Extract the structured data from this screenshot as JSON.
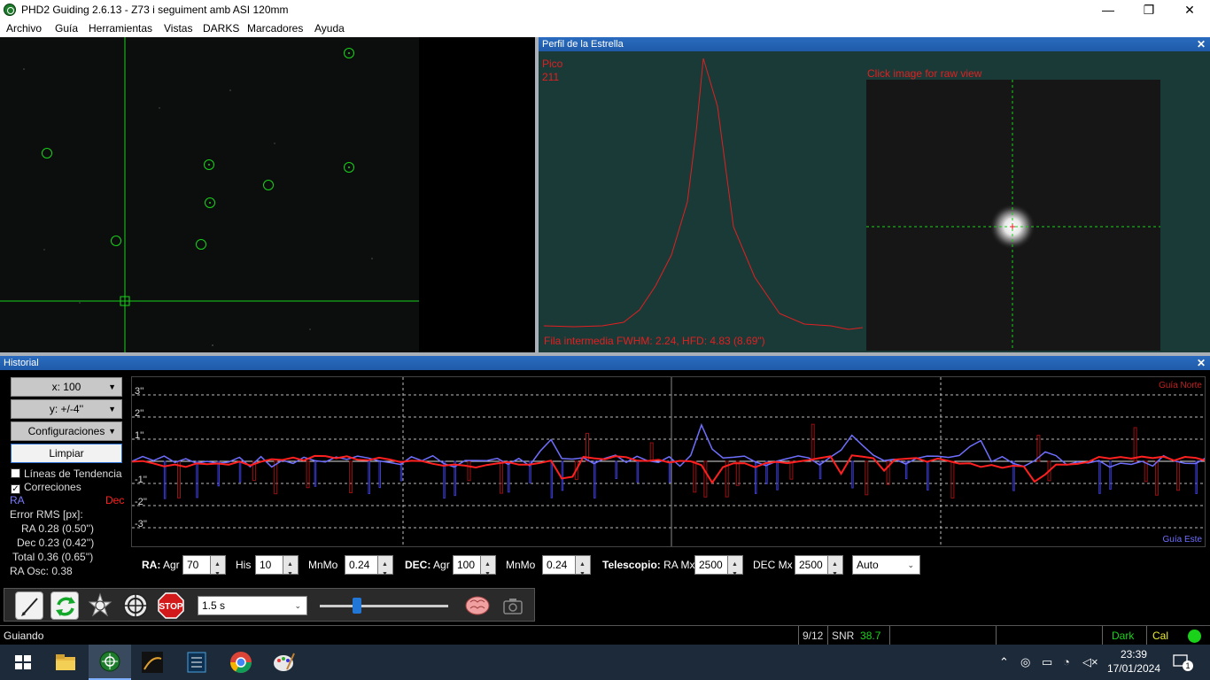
{
  "window": {
    "title": "PHD2 Guiding 2.6.13 - Z73 i seguiment amb ASI 120mm",
    "minimize": "—",
    "maximize": "❐",
    "close": "✕"
  },
  "menu": [
    "Archivo",
    "Guía",
    "Herramientas",
    "Vistas",
    "DARKS",
    "Marcadores",
    "Ayuda"
  ],
  "profile": {
    "title": "Perfil de la Estrella",
    "peak_label": "Pico",
    "peak_value": "211",
    "raw_hint": "Click image for raw view",
    "footer": "Fila intermedia FWHM: 2.24, HFD: 4.83 (8.69\")"
  },
  "history": {
    "title": "Historial",
    "x_scale": "x: 100",
    "y_scale": "y: +/-4''",
    "settings": "Configuraciones",
    "clear": "Limpiar",
    "trend_lines": "Líneas de Tendencia",
    "corrections": "Correciones",
    "ra_label": "RA",
    "dec_label": "Dec",
    "rms_title": "Error RMS [px]:",
    "rms_ra": "RA  0.28 (0.50'')",
    "rms_dec": "Dec  0.23 (0.42'')",
    "rms_total": "Total  0.36 (0.65'')",
    "ra_osc": "RA Osc: 0.38",
    "north_label": "Guía Norte",
    "east_label": "Guía Este",
    "y_ticks": [
      "3''",
      "2''",
      "1''",
      "-1''",
      "-2''",
      "-3''"
    ]
  },
  "params": {
    "ra": "RA:",
    "agr": "Agr",
    "ra_agr": "70",
    "his": "His",
    "ra_his": "10",
    "mnmo": "MnMo",
    "ra_mnmo": "0.24",
    "dec": "DEC:",
    "dec_agr": "100",
    "dec_mnmo": "0.24",
    "telescope": "Telescopio:",
    "ra_mx": "RA Mx",
    "ra_mx_val": "2500",
    "dec_mx": "DEC Mx",
    "dec_mx_val": "2500",
    "mode": "Auto"
  },
  "toolbar": {
    "exposure": "1.5 s",
    "stop_label": "STOP"
  },
  "status": {
    "state": "Guiando",
    "frames": "9/12",
    "snr_label": "SNR",
    "snr_value": "38.7",
    "dark": "Dark",
    "cal": "Cal"
  },
  "taskbar": {
    "time": "23:39",
    "date": "17/01/2024",
    "notif": "1"
  },
  "colors": {
    "ra": "#6f6fff",
    "dec": "#ff2020",
    "grid": "#bbbbbb",
    "stars": "#19d219"
  }
}
